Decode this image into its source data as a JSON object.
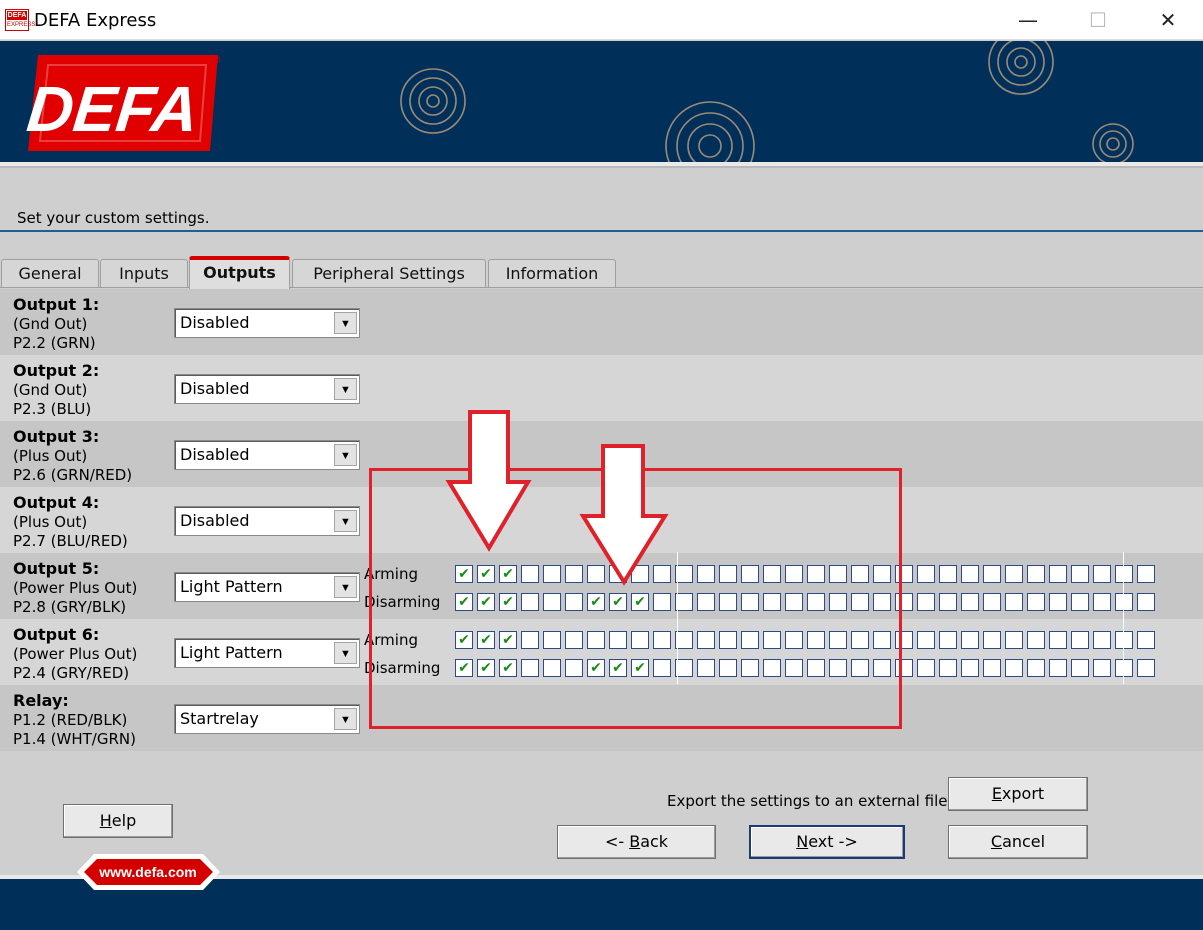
{
  "window": {
    "title": "DEFA Express",
    "icon_text_top": "DEFA",
    "icon_text_bottom": "EXPRESS",
    "controls": [
      "—",
      "☐",
      "✕"
    ]
  },
  "banner": {
    "logo_text": "DEFA",
    "registered_mark": "®"
  },
  "subtitle": "Set your custom settings.",
  "tabs": [
    {
      "label": "General"
    },
    {
      "label": "Inputs"
    },
    {
      "label": "Outputs",
      "active": true
    },
    {
      "label": "Peripheral Settings"
    },
    {
      "label": "Information"
    }
  ],
  "outputs": [
    {
      "name": "Output 1:",
      "line1": "(Gnd Out)",
      "line2": "P2.2 (GRN)",
      "value": "Disabled"
    },
    {
      "name": "Output 2:",
      "line1": "(Gnd Out)",
      "line2": "P2.3 (BLU)",
      "value": "Disabled"
    },
    {
      "name": "Output 3:",
      "line1": "(Plus Out)",
      "line2": "P2.6 (GRN/RED)",
      "value": "Disabled"
    },
    {
      "name": "Output 4:",
      "line1": "(Plus Out)",
      "line2": "P2.7 (BLU/RED)",
      "value": "Disabled"
    },
    {
      "name": "Output 5:",
      "line1": "(Power Plus Out)",
      "line2": "P2.8 (GRY/BLK)",
      "value": "Light Pattern",
      "arming_label": "Arming",
      "disarming_label": "Disarming",
      "arming_checked": [
        1,
        1,
        1,
        0,
        0,
        0,
        0,
        0,
        0,
        0,
        0,
        0,
        0,
        0,
        0,
        0,
        0,
        0,
        0,
        0,
        0,
        0,
        0,
        0,
        0,
        0,
        0,
        0,
        0,
        0,
        0,
        0
      ],
      "disarming_checked": [
        1,
        1,
        1,
        0,
        0,
        0,
        1,
        1,
        1,
        0,
        0,
        0,
        0,
        0,
        0,
        0,
        0,
        0,
        0,
        0,
        0,
        0,
        0,
        0,
        0,
        0,
        0,
        0,
        0,
        0,
        0,
        0
      ]
    },
    {
      "name": "Output 6:",
      "line1": "(Power Plus Out)",
      "line2": "P2.4 (GRY/RED)",
      "value": "Light Pattern",
      "arming_label": "Arming",
      "disarming_label": "Disarming",
      "arming_checked": [
        1,
        1,
        1,
        0,
        0,
        0,
        0,
        0,
        0,
        0,
        0,
        0,
        0,
        0,
        0,
        0,
        0,
        0,
        0,
        0,
        0,
        0,
        0,
        0,
        0,
        0,
        0,
        0,
        0,
        0,
        0,
        0
      ],
      "disarming_checked": [
        1,
        1,
        1,
        0,
        0,
        0,
        1,
        1,
        1,
        0,
        0,
        0,
        0,
        0,
        0,
        0,
        0,
        0,
        0,
        0,
        0,
        0,
        0,
        0,
        0,
        0,
        0,
        0,
        0,
        0,
        0,
        0
      ]
    },
    {
      "name": "Relay:",
      "line1": "P1.2 (RED/BLK)",
      "line2": "P1.4 (WHT/GRN)",
      "value": "Startrelay"
    }
  ],
  "check_glyph": "✔",
  "dropdown_glyph": "▼",
  "export_text": "Export the settings to an external file:",
  "buttons": {
    "export": {
      "mnemonic": "E",
      "rest": "xport"
    },
    "help": {
      "mnemonic": "H",
      "rest": "elp"
    },
    "back": {
      "pre": "<- ",
      "mnemonic": "B",
      "rest": "ack"
    },
    "next": {
      "mnemonic": "N",
      "rest": "ext ->"
    },
    "cancel": {
      "mnemonic": "C",
      "rest": "ancel"
    }
  },
  "footer_link": "www.defa.com",
  "colors": {
    "navy": "#00305a",
    "defa_red": "#d40000",
    "highlight_red": "#e0202a",
    "tab_accent": "#d40000"
  }
}
